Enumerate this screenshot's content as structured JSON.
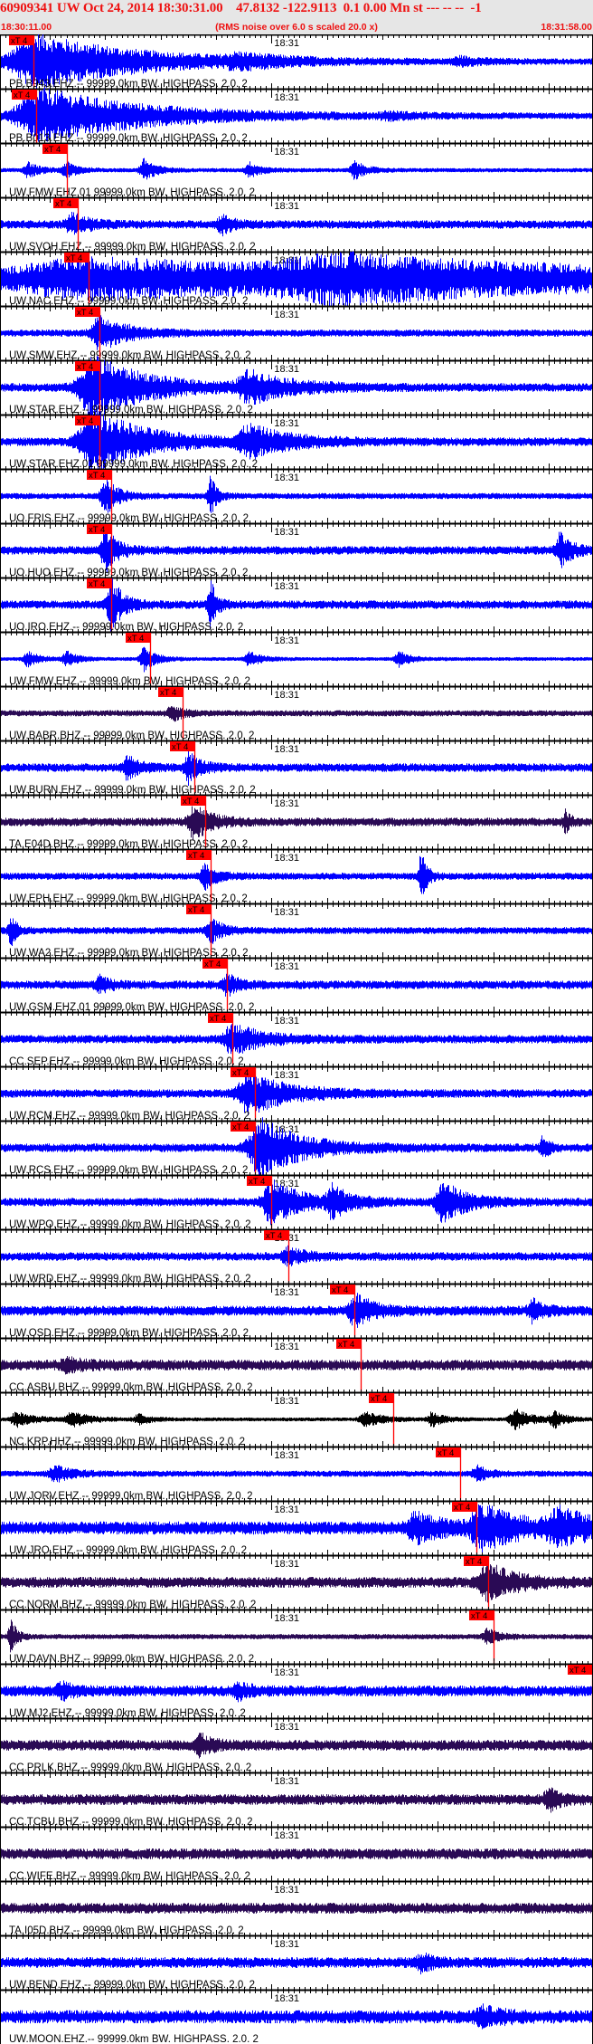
{
  "header": {
    "title": "60909341 UW Oct 24, 2014 18:30:31.00    47.8132 -122.9113  0.1 0.00 Mn st --- -- --  -1",
    "start_time": "18:30:11.00",
    "end_time": "18:31:58.00",
    "rms_note": "(RMS noise over 6.0 s scaled 20.0 x)"
  },
  "colors": {
    "header_text": "#ee1111",
    "header_bg": "#e6e6e6",
    "pick": "#ff0000",
    "blue": "#0000ff",
    "purple": "#2a0a55",
    "black": "#000000"
  },
  "chart_data": {
    "type": "line",
    "title": "60909341 UW Oct 24, 2014 18:30:31.00",
    "x_unit": "seconds after 18:30:11.00",
    "xlim": [
      0,
      107
    ],
    "x_tick_label": "18:31",
    "x_tick_label_seconds": 49,
    "major_tick_seconds": 10,
    "minor_tick_seconds": 1,
    "pick_label": "xT 4",
    "traces": [
      {
        "label": "PB.B943.EHZ.-- 99999.0km BW. HIGHPASS. 2.0. 2",
        "color": "blue",
        "pick_s": 6.0,
        "noise": 0.1,
        "bursts": [
          [
            7,
            1.1,
            18
          ],
          [
            43,
            0.2,
            8
          ],
          [
            83,
            0.15,
            4
          ]
        ]
      },
      {
        "label": "PB.B013.EHZ.-- 99999.0km BW. HIGHPASS. 2.0. 2",
        "color": "blue",
        "pick_s": 6.5,
        "noise": 0.1,
        "bursts": [
          [
            8,
            1.1,
            18
          ],
          [
            70,
            0.1,
            5
          ]
        ]
      },
      {
        "label": "UW.FMW.EHZ.01 99999.0km BW. HIGHPASS. 2.0. 2",
        "color": "blue",
        "pick_s": 12.1,
        "noise": 0.06,
        "bursts": [
          [
            5,
            0.3,
            2
          ],
          [
            12,
            0.3,
            2
          ],
          [
            26,
            0.45,
            2
          ],
          [
            45,
            0.3,
            2
          ],
          [
            64,
            0.35,
            2
          ]
        ]
      },
      {
        "label": "UW.SVOH.EHZ.-- 99999.0km BW. HIGHPASS. 2.0. 2",
        "color": "blue",
        "pick_s": 14.0,
        "noise": 0.15,
        "bursts": [
          [
            13,
            0.4,
            3
          ],
          [
            40,
            0.35,
            2
          ]
        ]
      },
      {
        "label": "UW.NAC.EHZ.-- 99999.0km BW. HIGHPASS. 2.0. 2",
        "color": "blue",
        "pick_s": 16.0,
        "noise": 0.25,
        "bursts": [
          [
            17,
            0.7,
            60
          ],
          [
            62,
            0.6,
            40
          ]
        ]
      },
      {
        "label": "UW.SMW.EHZ.-- 99999.0km BW. HIGHPASS. 2.0. 2",
        "color": "blue",
        "pick_s": 17.9,
        "noise": 0.12,
        "bursts": [
          [
            18,
            0.7,
            5
          ]
        ]
      },
      {
        "label": "UW.STAR.EHZ.-- 99999.0km BW. HIGHPASS. 2.0. 2",
        "color": "blue",
        "pick_s": 17.9,
        "noise": 0.15,
        "bursts": [
          [
            17,
            1.3,
            9
          ],
          [
            45,
            0.6,
            7
          ]
        ]
      },
      {
        "label": "UW.STAR.EHZ.01 99999.0km BW. HIGHPASS. 2.0. 2",
        "color": "blue",
        "pick_s": 17.9,
        "noise": 0.15,
        "bursts": [
          [
            17,
            1.3,
            9
          ],
          [
            45,
            0.6,
            7
          ]
        ]
      },
      {
        "label": "UO.FRIS.EHZ.-- 99999.0km BW. HIGHPASS. 2.0. 2",
        "color": "blue",
        "pick_s": 20.1,
        "noise": 0.1,
        "bursts": [
          [
            19,
            0.8,
            2
          ],
          [
            38,
            0.9,
            1
          ]
        ]
      },
      {
        "label": "UO.HUO.EHZ.-- 99999.0km BW. HIGHPASS. 2.0. 2",
        "color": "blue",
        "pick_s": 20.1,
        "noise": 0.15,
        "bursts": [
          [
            19,
            0.9,
            2
          ],
          [
            101,
            0.7,
            2
          ]
        ]
      },
      {
        "label": "UO.IRO.EHZ.-- 99999.0km BW. HIGHPASS. 2.0. 2",
        "color": "blue",
        "pick_s": 20.1,
        "noise": 0.15,
        "bursts": [
          [
            20,
            1.1,
            2
          ],
          [
            38,
            1.0,
            1
          ]
        ]
      },
      {
        "label": "UW.FMW.EHZ.-- 99999.0km BW. HIGHPASS. 2.0. 2",
        "color": "blue",
        "pick_s": 27.1,
        "noise": 0.05,
        "bursts": [
          [
            5,
            0.3,
            2
          ],
          [
            12,
            0.3,
            2
          ],
          [
            26,
            0.5,
            2
          ],
          [
            45,
            0.3,
            2
          ],
          [
            72,
            0.3,
            2
          ]
        ]
      },
      {
        "label": "UW.BABR.BHZ.-- 99999.0km BW. HIGHPASS. 2.0. 2",
        "color": "purple",
        "pick_s": 33.0,
        "noise": 0.1,
        "bursts": [
          [
            31,
            0.3,
            2
          ]
        ]
      },
      {
        "label": "UW.BURN.EHZ.-- 99999.0km BW. HIGHPASS. 2.0. 2",
        "color": "blue",
        "pick_s": 35.1,
        "noise": 0.15,
        "bursts": [
          [
            23,
            0.5,
            2
          ],
          [
            34,
            0.6,
            2
          ]
        ]
      },
      {
        "label": "TA.E04D.BHZ.-- 99999.0km BW. HIGHPASS. 2.0. 2",
        "color": "purple",
        "pick_s": 37.0,
        "noise": 0.15,
        "bursts": [
          [
            35,
            0.7,
            3
          ],
          [
            102,
            0.4,
            1
          ]
        ]
      },
      {
        "label": "UW.EPH.EHZ.-- 99999.0km BW. HIGHPASS. 2.0. 2",
        "color": "blue",
        "pick_s": 38.0,
        "noise": 0.12,
        "bursts": [
          [
            37,
            0.5,
            2
          ],
          [
            76,
            1.0,
            1
          ]
        ]
      },
      {
        "label": "UW.WA2.EHZ.-- 99999.0km BW. HIGHPASS. 2.0. 2",
        "color": "blue",
        "pick_s": 38.0,
        "noise": 0.12,
        "bursts": [
          [
            2,
            0.6,
            1
          ],
          [
            38,
            0.5,
            2
          ]
        ]
      },
      {
        "label": "UW.GSM.EHZ.01 99999.0km BW. HIGHPASS. 2.0. 2",
        "color": "blue",
        "pick_s": 40.9,
        "noise": 0.15,
        "bursts": [
          [
            18,
            0.3,
            2
          ],
          [
            41,
            0.4,
            2
          ]
        ]
      },
      {
        "label": "CC.SEP.EHZ.-- 99999.0km BW. HIGHPASS. 2.0. 2",
        "color": "blue",
        "pick_s": 41.9,
        "noise": 0.15,
        "bursts": [
          [
            42,
            0.6,
            5
          ]
        ]
      },
      {
        "label": "UW.RCM.EHZ.-- 99999.0km BW. HIGHPASS. 2.0. 2",
        "color": "blue",
        "pick_s": 46.0,
        "noise": 0.15,
        "bursts": [
          [
            45,
            0.8,
            7
          ]
        ]
      },
      {
        "label": "UW.RCS.EHZ.-- 99999.0km BW. HIGHPASS. 2.0. 2",
        "color": "blue",
        "pick_s": 46.0,
        "noise": 0.15,
        "bursts": [
          [
            47,
            1.2,
            7
          ],
          [
            98,
            0.5,
            1
          ]
        ]
      },
      {
        "label": "UW.WPO.EHZ.-- 99999.0km BW. HIGHPASS. 2.0. 2",
        "color": "blue",
        "pick_s": 48.9,
        "noise": 0.15,
        "bursts": [
          [
            49,
            0.9,
            5
          ],
          [
            60,
            0.6,
            3
          ],
          [
            80,
            0.8,
            4
          ]
        ]
      },
      {
        "label": "UW.WRD.EHZ.-- 99999.0km BW. HIGHPASS. 2.0. 2",
        "color": "blue",
        "pick_s": 52.0,
        "noise": 0.15,
        "bursts": [
          [
            52,
            0.3,
            3
          ]
        ]
      },
      {
        "label": "UW.OSD.EHZ.-- 99999.0km BW. HIGHPASS. 2.0. 2",
        "color": "blue",
        "pick_s": 63.9,
        "noise": 0.18,
        "bursts": [
          [
            64,
            0.7,
            3
          ],
          [
            96,
            0.4,
            2
          ]
        ]
      },
      {
        "label": "CC.ASBU.BHZ.-- 99999.0km BW. HIGHPASS. 2.0. 2",
        "color": "purple",
        "pick_s": 65.1,
        "noise": 0.2,
        "bursts": [
          [
            12,
            0.2,
            3
          ]
        ]
      },
      {
        "label": "NC.KRP.HHZ.-- 99999.0km BW. HIGHPASS. 2.0. 2",
        "color": "black",
        "pick_s": 71.0,
        "noise": 0.05,
        "bursts": [
          [
            3,
            0.3,
            3
          ],
          [
            13,
            0.3,
            3
          ],
          [
            25,
            0.2,
            2
          ],
          [
            66,
            0.3,
            3
          ],
          [
            78,
            0.3,
            2
          ],
          [
            93,
            0.4,
            3
          ],
          [
            100,
            0.3,
            2
          ]
        ]
      },
      {
        "label": "UW.JORV.EHZ.-- 99999.0km BW. HIGHPASS. 2.0. 2",
        "color": "blue",
        "pick_s": 83.0,
        "noise": 0.1,
        "bursts": [
          [
            10,
            0.3,
            3
          ],
          [
            86,
            0.3,
            2
          ]
        ]
      },
      {
        "label": "UW.JRO.EHZ.-- 99999.0km BW. HIGHPASS. 2.0. 2",
        "color": "blue",
        "pick_s": 86.0,
        "noise": 0.25,
        "bursts": [
          [
            75,
            0.5,
            5
          ],
          [
            87,
            0.8,
            7
          ],
          [
            101,
            0.6,
            7
          ]
        ]
      },
      {
        "label": "CC.NORM.BHZ.-- 99999.0km BW. HIGHPASS. 2.0. 2",
        "color": "purple",
        "pick_s": 88.1,
        "noise": 0.2,
        "bursts": [
          [
            88,
            0.7,
            5
          ]
        ]
      },
      {
        "label": "UW.DAVN.BHZ.-- 99999.0km BW. HIGHPASS. 2.0. 2",
        "color": "purple",
        "pick_s": 89.1,
        "noise": 0.08,
        "bursts": [
          [
            2,
            0.7,
            1
          ],
          [
            88,
            0.3,
            2
          ]
        ]
      },
      {
        "label": "UW.MJ2.EHZ.-- 99999.0km BW. HIGHPASS. 2.0. 2",
        "color": "blue",
        "pick_s": 107.0,
        "noise": 0.2,
        "bursts": [
          [
            11,
            0.3,
            2
          ],
          [
            43,
            0.3,
            2
          ]
        ]
      },
      {
        "label": "CC.PRLK.BHZ.-- 99999.0km BW. HIGHPASS. 2.0. 2",
        "color": "purple",
        "pick_s": null,
        "noise": 0.2,
        "bursts": [
          [
            36,
            0.4,
            2
          ]
        ]
      },
      {
        "label": "CC.TCBU.BHZ.-- 99999.0km BW. HIGHPASS. 2.0. 2",
        "color": "purple",
        "pick_s": null,
        "noise": 0.2,
        "bursts": [
          [
            99,
            0.4,
            2
          ]
        ]
      },
      {
        "label": "CC.WIFE.BHZ.-- 99999.0km BW. HIGHPASS. 2.0. 2",
        "color": "purple",
        "pick_s": null,
        "noise": 0.2,
        "bursts": []
      },
      {
        "label": "TA.I05D.BHZ.-- 99999.0km BW. HIGHPASS. 2.0. 2",
        "color": "purple",
        "pick_s": null,
        "noise": 0.2,
        "bursts": []
      },
      {
        "label": "UW.BEND.EHZ.-- 99999.0km BW. HIGHPASS. 2.0. 2",
        "color": "blue",
        "pick_s": null,
        "noise": 0.2,
        "bursts": [
          [
            76,
            0.3,
            2
          ]
        ]
      },
      {
        "label": "UW.MOON.EHZ.-- 99999.0km BW. HIGHPASS. 2.0. 2",
        "color": "blue",
        "pick_s": null,
        "noise": 0.25,
        "bursts": [
          [
            87,
            0.3,
            4
          ]
        ]
      }
    ]
  }
}
